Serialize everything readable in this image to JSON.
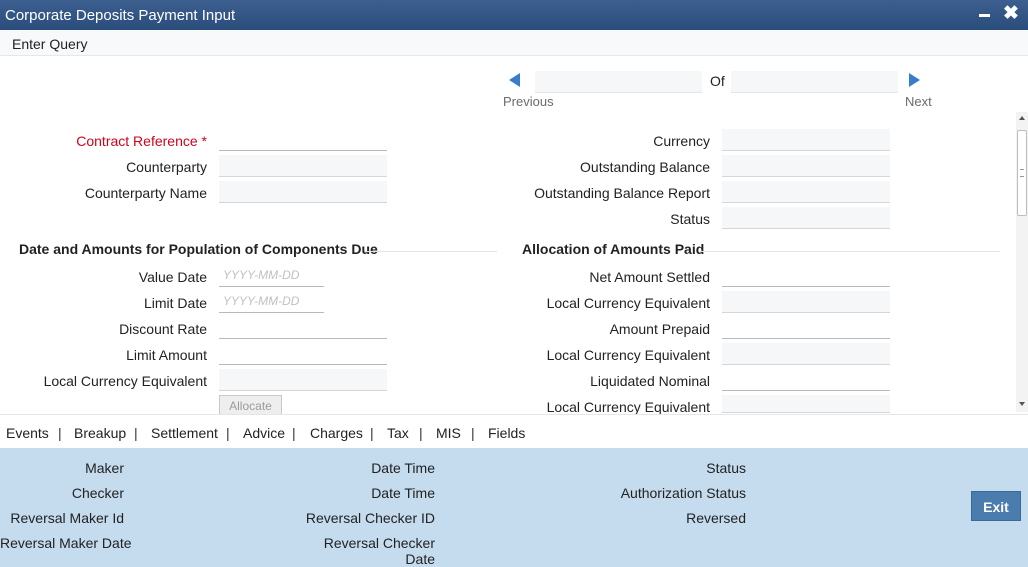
{
  "window": {
    "title": "Corporate Deposits Payment Input",
    "minimize_icon": "minimize-icon",
    "close_label": "✖"
  },
  "toolbar": {
    "enter_query": "Enter Query"
  },
  "nav": {
    "of": "Of",
    "previous": "Previous",
    "next": "Next",
    "prev_icon": "left-arrow-icon",
    "next_icon": "right-arrow-icon"
  },
  "header_fields": {
    "contract_reference": "Contract Reference",
    "required_mark": "*",
    "counterparty": "Counterparty",
    "counterparty_name": "Counterparty Name",
    "currency": "Currency",
    "outstanding_balance": "Outstanding Balance",
    "outstanding_balance_report": "Outstanding Balance Report",
    "status": "Status"
  },
  "left_section": {
    "title": "Date and Amounts for Population of Components Due",
    "value_date": "Value Date",
    "value_date_placeholder": "YYYY-MM-DD",
    "limit_date": "Limit Date",
    "limit_date_placeholder": "YYYY-MM-DD",
    "discount_rate": "Discount Rate",
    "limit_amount": "Limit Amount",
    "local_currency_equivalent": "Local Currency Equivalent",
    "allocate_button": "Allocate"
  },
  "right_section": {
    "title": "Allocation of Amounts Paid",
    "net_amount_settled": "Net Amount Settled",
    "lce_1": "Local Currency Equivalent",
    "amount_prepaid": "Amount Prepaid",
    "lce_2": "Local Currency Equivalent",
    "liquidated_nominal": "Liquidated Nominal",
    "lce_3": "Local Currency Equivalent"
  },
  "tabs": [
    "Events",
    "Breakup",
    "Settlement",
    "Advice",
    "Charges",
    "Tax",
    "MIS",
    "Fields"
  ],
  "tab_separator": "|",
  "footer": {
    "maker": "Maker",
    "checker": "Checker",
    "reversal_maker_id": "Reversal Maker Id",
    "reversal_maker_date": "Reversal Maker Date",
    "date_time_1": "Date Time",
    "date_time_2": "Date Time",
    "reversal_checker_id": "Reversal Checker ID",
    "reversal_checker_date_line1": "Reversal Checker",
    "reversal_checker_date_line2": "Date",
    "status": "Status",
    "authorization_status": "Authorization Status",
    "reversed": "Reversed",
    "exit": "Exit"
  }
}
